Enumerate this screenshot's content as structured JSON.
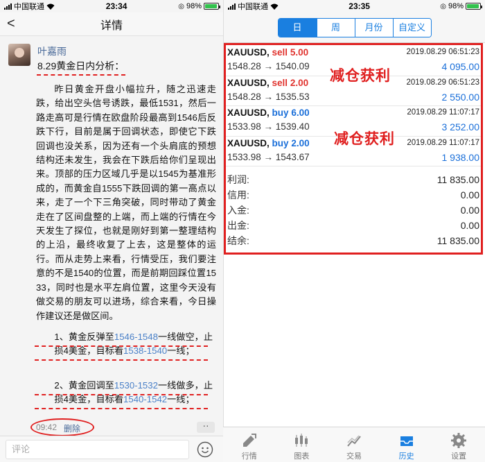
{
  "left": {
    "status": {
      "carrier": "中国联通",
      "time": "23:34",
      "battery": "98%"
    },
    "nav": {
      "back": "<",
      "title": "详情"
    },
    "post": {
      "author": "叶嘉雨",
      "title": "8.29黄金日内分析：",
      "body": "昨日黄金开盘小幅拉升，随之迅速走跌，给出空头信号诱跌，最低1531，然后一路走高可是行情在欧盘阶段最高到1546后反跌下行，目前是属于回调状态，即使它下跌回调也没关系，因为还有一个头肩底的预想结构还未发生，我会在下跌后给你们呈现出来。顶部的压力区域几乎是以1545为基准形成的，而黄金自1555下跌回调的第一高点以来，走了一个下三角突破，同时带动了黄金走在了区间盘整的上端，而上端的行情在今天发生了探位，也就是刚好到第一整理结构的上沿，最终收复了上去，这是整体的运行。而从走势上来看，行情受压，我们要注意的不是1540的位置，而是前期回踩位置1533，同时也是水平左肩位置，这里今天没有做交易的朋友可以进场，综合来看，今日操作建议还是做区间。",
      "plan1": {
        "a": "1、黄金反弹至",
        "range": "1546-1548",
        "b": "一线做空，止损4美金，目标看",
        "target": "1538-1540",
        "c": "一线；"
      },
      "plan2": {
        "a": "2、黄金回调至",
        "range": "1530-1532",
        "b": "一线做多，止损4美金，目标看",
        "target": "1540-1542",
        "c": "一线；"
      },
      "time": "09:42",
      "delete": "删除",
      "more": "··"
    },
    "comment": {
      "placeholder": "评论"
    }
  },
  "right": {
    "status": {
      "carrier": "中国联通",
      "time": "23:35",
      "battery": "98%"
    },
    "segments": [
      "日",
      "周",
      "月份",
      "自定义"
    ],
    "active_segment": "日",
    "trades": [
      {
        "symbol": "XAUUSD,",
        "side": "sell",
        "lots": "5.00",
        "date": "2019.08.29 06:51:23",
        "prices": "1548.28 → 1540.09",
        "profit": "4 095.00"
      },
      {
        "symbol": "XAUUSD,",
        "side": "sell",
        "lots": "2.00",
        "date": "2019.08.29 06:51:23",
        "prices": "1548.28 → 1535.53",
        "profit": "2 550.00"
      },
      {
        "symbol": "XAUUSD,",
        "side": "buy",
        "lots": "6.00",
        "date": "2019.08.29 11:07:17",
        "prices": "1533.98 → 1539.40",
        "profit": "3 252.00"
      },
      {
        "symbol": "XAUUSD,",
        "side": "buy",
        "lots": "2.00",
        "date": "2019.08.29 11:07:17",
        "prices": "1533.98 → 1543.67",
        "profit": "1 938.00"
      }
    ],
    "annotation_1": "减仓获利",
    "annotation_2": "减仓获利",
    "summary": [
      {
        "label": "利润:",
        "value": "11 835.00"
      },
      {
        "label": "信用:",
        "value": "0.00"
      },
      {
        "label": "入金:",
        "value": "0.00"
      },
      {
        "label": "出金:",
        "value": "0.00"
      },
      {
        "label": "结余:",
        "value": "11 835.00"
      }
    ],
    "tabs": [
      "行情",
      "图表",
      "交易",
      "历史",
      "设置"
    ],
    "active_tab": "历史"
  },
  "colors": {
    "accent": "#1a7fe0",
    "sell": "#e0322d",
    "buy": "#1a6fd9",
    "annotation": "#e02020"
  }
}
